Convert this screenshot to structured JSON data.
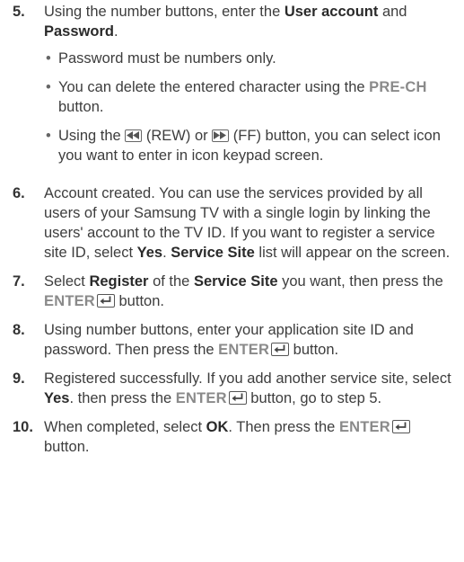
{
  "steps": [
    {
      "number": "5.",
      "t1": "Using the number buttons, enter the ",
      "b1": "User account",
      "t2": " and ",
      "b2": "Password",
      "t3": ".",
      "bullets": {
        "b1": "Password must be numbers only.",
        "b2_pre": "You can delete the entered character using the ",
        "b2_key": "PRE-CH",
        "b2_post": " button.",
        "b3_pre": "Using the ",
        "b3_rew": " (REW) or ",
        "b3_ff": " (FF) button, you can select icon you want to enter in icon keypad screen."
      }
    },
    {
      "number": "6.",
      "t1": "Account created. You can use the services provided by all users of your Samsung TV with a single login by linking the users' account to the TV ID. If you want to register a service site ID, select ",
      "b1": "Yes",
      "t2": ". ",
      "b2": "Service Site",
      "t3": " list will appear on the screen."
    },
    {
      "number": "7.",
      "t1": "Select ",
      "b1": "Register",
      "t2": " of the ",
      "b2": "Service Site",
      "t3": " you want, then press the ",
      "key": "ENTER",
      "t4": " button."
    },
    {
      "number": "8.",
      "t1": "Using number buttons, enter your application site ID and password. Then press the ",
      "key": "ENTER",
      "t2": " button."
    },
    {
      "number": "9.",
      "t1": "Registered successfully. If you add another service site, select ",
      "b1": "Yes",
      "t2": ". then press the ",
      "key": "ENTER",
      "t3": " button, go to step 5."
    },
    {
      "number": "10.",
      "t1": "When completed, select ",
      "b1": "OK",
      "t2": ". Then press the ",
      "key": "ENTER",
      "t3": " button."
    }
  ],
  "icons": {
    "enter": "enter-return-icon",
    "rew": "rewind-icon",
    "ff": "fast-forward-icon"
  }
}
